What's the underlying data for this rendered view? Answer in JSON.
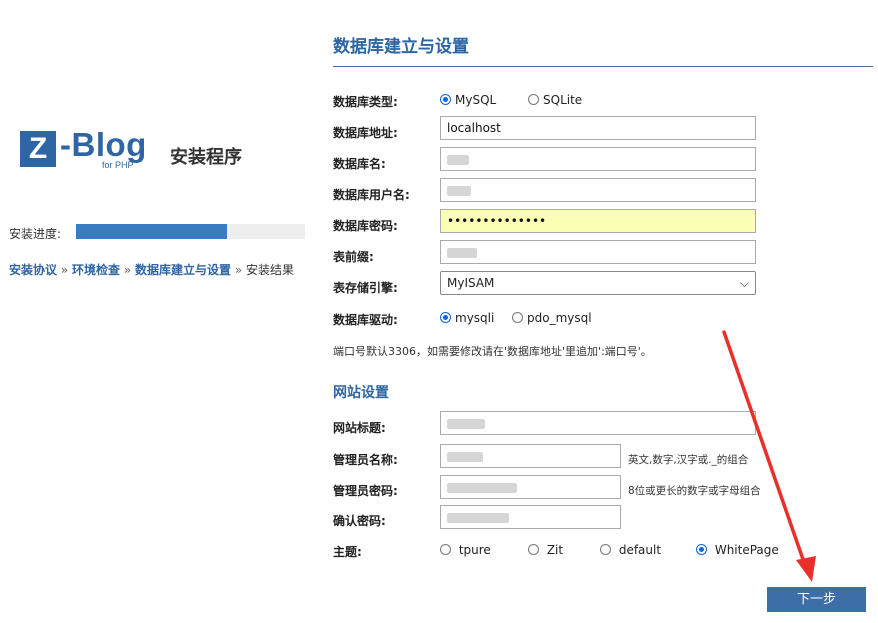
{
  "sidebar": {
    "logo": {
      "mark": "Z",
      "name": "-Blog",
      "sub": "for PHP",
      "installer": "安装程序"
    },
    "progress": {
      "label": "安装进度:",
      "fraction": 0.66
    },
    "steps": [
      "安装协议",
      "环境检查",
      "数据库建立与设置",
      "安装结果"
    ],
    "step_separator": "»",
    "completed_steps": 3
  },
  "db": {
    "title": "数据库建立与设置",
    "type_label": "数据库类型:",
    "type_options": [
      "MySQL",
      "SQLite"
    ],
    "type_selected": "MySQL",
    "host_label": "数据库地址:",
    "host_value": "localhost",
    "name_label": "数据库名:",
    "user_label": "数据库用户名:",
    "password_label": "数据库密码:",
    "password_value": "••••••••••••••",
    "prefix_label": "表前缀:",
    "engine_label": "表存储引擎:",
    "engine_value": "MyISAM",
    "driver_label": "数据库驱动:",
    "driver_options": [
      "mysqli",
      "pdo_mysql"
    ],
    "driver_selected": "mysqli",
    "port_note": "端口号默认3306，如需要修改请在'数据库地址'里追加':端口号'。"
  },
  "site": {
    "heading": "网站设置",
    "title_label": "网站标题:",
    "admin_name_label": "管理员名称:",
    "admin_name_hint": "英文,数字,汉字或._的组合",
    "admin_password_label": "管理员密码:",
    "admin_password_hint": "8位或更长的数字或字母组合",
    "confirm_password_label": "确认密码:",
    "theme_label": "主题:",
    "theme_options": [
      "tpure",
      "Zit",
      "default",
      "WhitePage"
    ],
    "theme_selected": "WhitePage"
  },
  "next_label": "下一步",
  "colors": {
    "accent": "#2e65a4",
    "button": "#3d6ea7",
    "annotation_arrow": "#e8302a",
    "password_fill": "#fbffb5"
  }
}
